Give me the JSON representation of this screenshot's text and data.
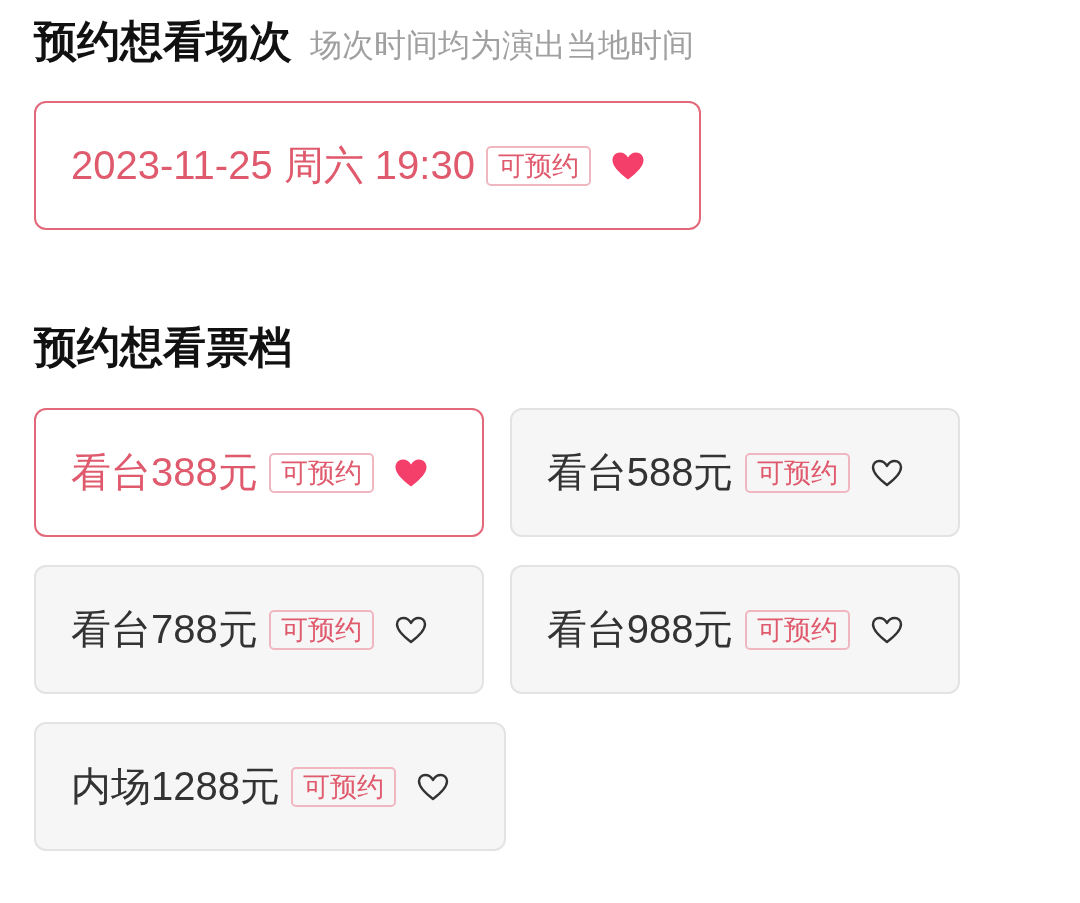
{
  "session_section": {
    "title": "预约想看场次",
    "note": "场次时间均为演出当地时间",
    "sessions": [
      {
        "label": "2023-11-25 周六 19:30",
        "badge": "可预约",
        "selected": true
      }
    ]
  },
  "ticket_section": {
    "title": "预约想看票档",
    "tiers": [
      {
        "label": "看台388元",
        "badge": "可预约",
        "selected": true
      },
      {
        "label": "看台588元",
        "badge": "可预约",
        "selected": false
      },
      {
        "label": "看台788元",
        "badge": "可预约",
        "selected": false
      },
      {
        "label": "看台988元",
        "badge": "可预约",
        "selected": false
      },
      {
        "label": "内场1288元",
        "badge": "可预约",
        "selected": false
      }
    ]
  }
}
